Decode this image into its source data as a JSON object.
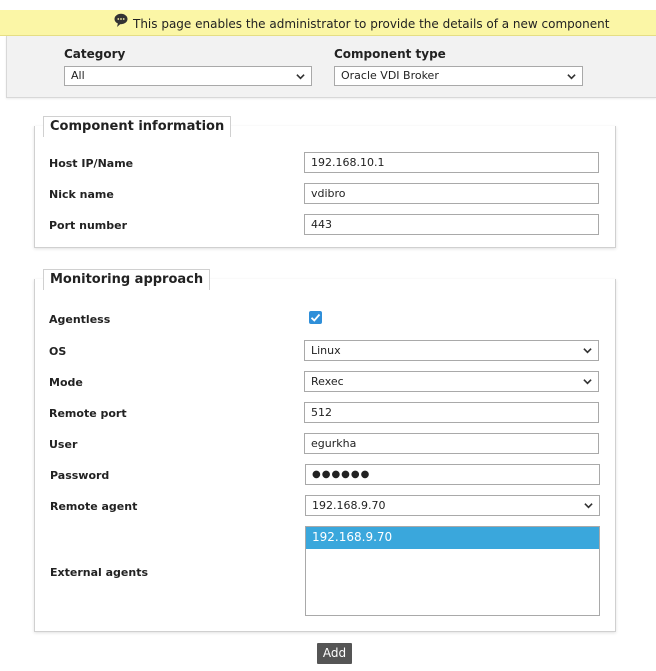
{
  "banner": {
    "message": "This page enables the administrator to provide the details of a new component",
    "icon": "speech-bubble-icon",
    "background": "#fbf6a6"
  },
  "selectors": {
    "category_label": "Category",
    "category_value": "All",
    "component_type_label": "Component type",
    "component_type_value": "Oracle VDI Broker"
  },
  "component_info": {
    "legend": "Component information",
    "host_label": "Host IP/Name",
    "host_value": "192.168.10.1",
    "nick_label": "Nick name",
    "nick_value": "vdibro",
    "port_label": "Port number",
    "port_value": "443"
  },
  "monitoring": {
    "legend": "Monitoring approach",
    "agentless_label": "Agentless",
    "agentless_checked": true,
    "os_label": "OS",
    "os_value": "Linux",
    "mode_label": "Mode",
    "mode_value": "Rexec",
    "remote_port_label": "Remote port",
    "remote_port_value": "512",
    "user_label": "User",
    "user_value": "egurkha",
    "password_label": "Password",
    "password_value": "●●●●●●",
    "remote_agent_label": "Remote agent",
    "remote_agent_value": "192.168.9.70",
    "external_agents_label": "External agents",
    "external_agents_options": [
      "192.168.9.70"
    ]
  },
  "actions": {
    "add_label": "Add"
  },
  "colors": {
    "accent": "#3aa7dc",
    "checkbox": "#2f8fd9",
    "button": "#555555"
  }
}
